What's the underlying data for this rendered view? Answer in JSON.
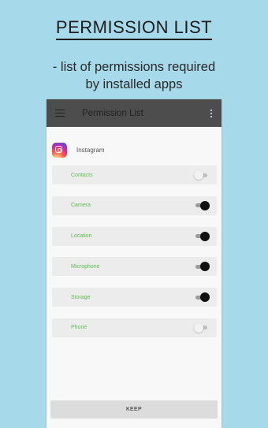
{
  "headline": "PERMISSION LIST",
  "subtitle_line1": "- list of permissions required",
  "subtitle_line2": "by installed apps",
  "appbar": {
    "title": "Permission List",
    "menu_icon": "hamburger-icon",
    "more_icon": "more-vert-icon"
  },
  "app": {
    "name": "Instagram",
    "icon": "instagram-icon"
  },
  "permissions": [
    {
      "label": "Contacts",
      "enabled": false
    },
    {
      "label": "Camera",
      "enabled": true
    },
    {
      "label": "Location",
      "enabled": true
    },
    {
      "label": "Microphone",
      "enabled": true
    },
    {
      "label": "Storage",
      "enabled": true
    },
    {
      "label": "Phone",
      "enabled": false
    }
  ],
  "keep_label": "KEEP",
  "colors": {
    "background": "#a6d9e9",
    "appbar": "#4d4d4d",
    "permission_label": "#5bbf4f"
  }
}
